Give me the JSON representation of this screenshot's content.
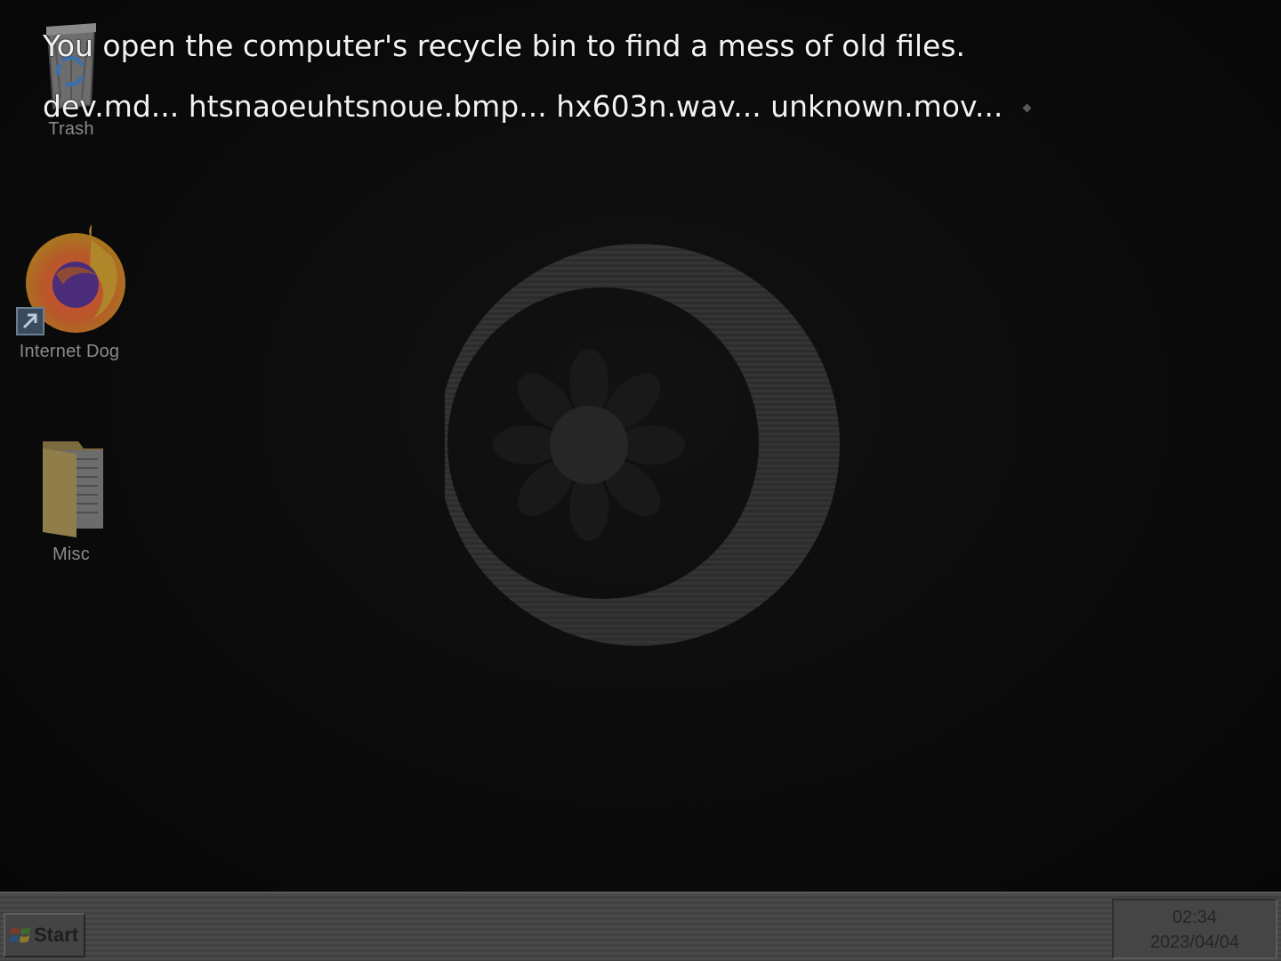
{
  "narration": {
    "line1": "You open the computer's recycle bin to find a mess of old files.",
    "line2": "dev.md... htsnaoeuhtsnoue.bmp... hx603n.wav... unknown.mov..."
  },
  "desktop": {
    "icons": [
      {
        "label": "Trash",
        "icon": "recycle-bin-icon"
      },
      {
        "label": "Internet Dog",
        "icon": "browser-icon"
      },
      {
        "label": "Misc",
        "icon": "folder-icon"
      }
    ],
    "wallpaper": "crescent-moon-flower-logo"
  },
  "taskbar": {
    "start_label": "Start",
    "clock_time": "02:34",
    "clock_date": "2023/04/04"
  },
  "colors": {
    "background": "#0b0b0b",
    "narration_text": "#f2f2f2",
    "taskbar": "#474747",
    "icon_label": "#8a8a8a"
  }
}
